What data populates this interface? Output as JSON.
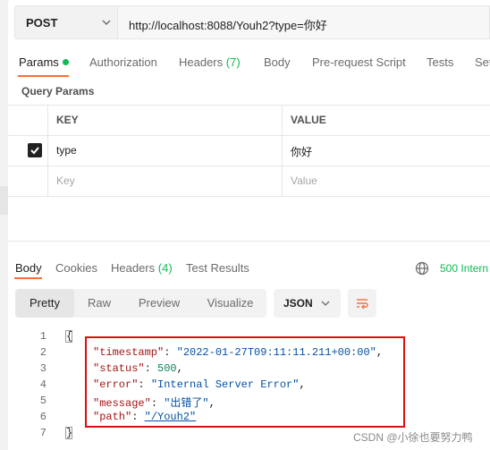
{
  "request": {
    "method": "POST",
    "url": "http://localhost:8088/Youh2?type=你好"
  },
  "request_tabs": [
    {
      "label": "Params",
      "active": true,
      "indicator": "green-dot"
    },
    {
      "label": "Authorization"
    },
    {
      "label": "Headers",
      "count": "(7)"
    },
    {
      "label": "Body"
    },
    {
      "label": "Pre-request Script"
    },
    {
      "label": "Tests"
    },
    {
      "label": "Set"
    }
  ],
  "query_params": {
    "title": "Query Params",
    "columns": [
      "KEY",
      "VALUE"
    ],
    "rows": [
      {
        "checked": true,
        "key": "type",
        "value": "你好"
      }
    ],
    "placeholder": {
      "key": "Key",
      "value": "Value"
    }
  },
  "response_tabs": [
    {
      "label": "Body",
      "active": true
    },
    {
      "label": "Cookies"
    },
    {
      "label": "Headers",
      "count": "(4)"
    },
    {
      "label": "Test Results"
    }
  ],
  "response_status": "500 Intern",
  "view_modes": [
    "Pretty",
    "Raw",
    "Preview",
    "Visualize"
  ],
  "active_view": "Pretty",
  "format": "JSON",
  "code": {
    "line_numbers": [
      "1",
      "2",
      "3",
      "4",
      "5",
      "6",
      "7"
    ],
    "open": "{",
    "close": "}",
    "fields": [
      {
        "key": "\"timestamp\"",
        "value": "\"2022-01-27T09:11:11.211+00:00\"",
        "type": "string"
      },
      {
        "key": "\"status\"",
        "value": "500",
        "type": "number"
      },
      {
        "key": "\"error\"",
        "value": "\"Internal Server Error\"",
        "type": "string"
      },
      {
        "key": "\"message\"",
        "value": "\"出错了\"",
        "type": "string"
      },
      {
        "key": "\"path\"",
        "value": "\"/Youh2\"",
        "type": "link"
      }
    ]
  },
  "highlight_color": "#e01010",
  "accent_color": "#ff6c37",
  "success_color": "#0cbb52",
  "watermark": "CSDN @小徐也要努力鸭"
}
